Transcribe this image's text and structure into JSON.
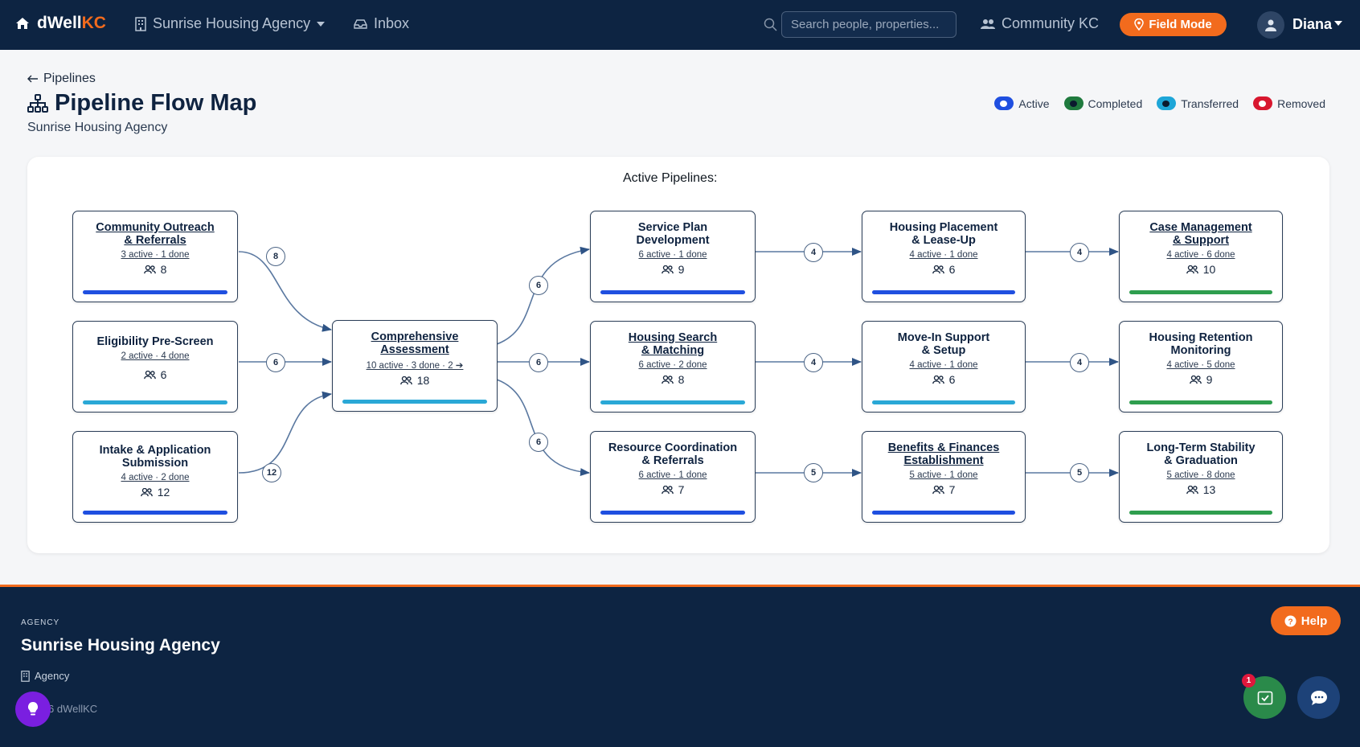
{
  "nav": {
    "brand_main": "dWell",
    "brand_accent": "KC",
    "agency": "Sunrise Housing Agency",
    "inbox": "Inbox",
    "search_placeholder": "Search people, properties...",
    "community": "Community KC",
    "field_mode": "Field Mode",
    "user": "Diana"
  },
  "header": {
    "back": "Pipelines",
    "title": "Pipeline Flow Map",
    "subtitle": "Sunrise Housing Agency"
  },
  "legend": [
    {
      "label": "Active",
      "color": "#1f4fe0"
    },
    {
      "label": "Completed",
      "color": "#1f7a3e"
    },
    {
      "label": "Transferred",
      "color": "#1ea6d8"
    },
    {
      "label": "Removed",
      "color": "#d8172f"
    }
  ],
  "canvas": {
    "active_label": "Active Pipelines:"
  },
  "nodes": [
    {
      "title_1": "Community Outreach",
      "title_2": "& Referrals",
      "stats": "3 active · 1 done",
      "count": "8",
      "bar": "#1f4fe0"
    },
    {
      "title_1": "Eligibility Pre-Screen",
      "title_2": "",
      "stats": "2 active · 4 done",
      "count": "6",
      "bar": "#2aa8d6"
    },
    {
      "title_1": "Intake & Application",
      "title_2": "Submission",
      "stats": "4 active · 2 done",
      "count": "12",
      "bar": "#1f4fe0"
    },
    {
      "title_1": "Comprehensive",
      "title_2": "Assessment",
      "stats": "10 active · 3 done · 2 ➔",
      "count": "18",
      "bar": "#2aa8d6"
    },
    {
      "title_1": "Service Plan",
      "title_2": "Development",
      "stats": "6 active · 1 done",
      "count": "9",
      "bar": "#1f4fe0"
    },
    {
      "title_1": "Housing Search",
      "title_2": "& Matching",
      "stats": "6 active · 2 done",
      "count": "8",
      "bar": "#2aa8d6"
    },
    {
      "title_1": "Resource Coordination",
      "title_2": "& Referrals",
      "stats": "6 active · 1 done",
      "count": "7",
      "bar": "#1f4fe0"
    },
    {
      "title_1": "Housing Placement",
      "title_2": "& Lease-Up",
      "stats": "4 active · 1 done",
      "count": "6",
      "bar": "#1f4fe0"
    },
    {
      "title_1": "Move-In Support",
      "title_2": "& Setup",
      "stats": "4 active · 1 done",
      "count": "6",
      "bar": "#2aa8d6"
    },
    {
      "title_1": "Benefits & Finances",
      "title_2": "Establishment",
      "stats": "5 active · 1 done",
      "count": "7",
      "bar": "#1f4fe0"
    },
    {
      "title_1": "Case Management",
      "title_2": "& Support",
      "stats": "4 active · 6 done",
      "count": "10",
      "bar": "#2e9e4e"
    },
    {
      "title_1": "Housing Retention",
      "title_2": "Monitoring",
      "stats": "4 active · 5 done",
      "count": "9",
      "bar": "#2e9e4e"
    },
    {
      "title_1": "Long-Term Stability",
      "title_2": "& Graduation",
      "stats": "5 active · 8 done",
      "count": "13",
      "bar": "#2e9e4e"
    }
  ],
  "edges": [
    {
      "label": "8"
    },
    {
      "label": "6"
    },
    {
      "label": "12"
    },
    {
      "label": "6"
    },
    {
      "label": "6"
    },
    {
      "label": "6"
    },
    {
      "label": "4"
    },
    {
      "label": "4"
    },
    {
      "label": "5"
    },
    {
      "label": "4"
    },
    {
      "label": "4"
    },
    {
      "label": "5"
    }
  ],
  "footer": {
    "label": "AGENCY",
    "name": "Sunrise Housing Agency",
    "type": "Agency",
    "copyright": "6 dWellKC",
    "help": "Help",
    "notifications": "1"
  }
}
